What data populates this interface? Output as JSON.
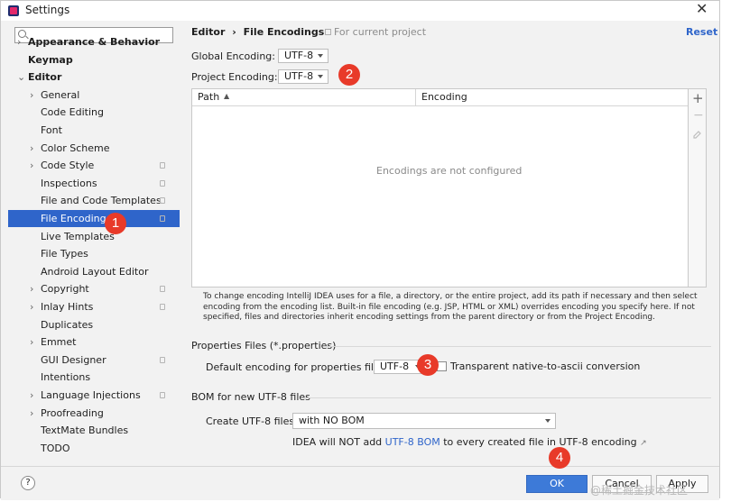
{
  "window": {
    "title": "Settings",
    "close_glyph": "✕"
  },
  "sidebar": {
    "search_placeholder": "",
    "items": [
      {
        "label": "Appearance & Behavior",
        "arrow": "›",
        "level": 0,
        "copy": false
      },
      {
        "label": "Keymap",
        "arrow": "",
        "level": 0,
        "copy": false
      },
      {
        "label": "Editor",
        "arrow": "⌄",
        "level": 0,
        "copy": false
      },
      {
        "label": "General",
        "arrow": "›",
        "level": 1,
        "copy": false
      },
      {
        "label": "Code Editing",
        "arrow": "",
        "level": 1,
        "copy": false
      },
      {
        "label": "Font",
        "arrow": "",
        "level": 1,
        "copy": false
      },
      {
        "label": "Color Scheme",
        "arrow": "›",
        "level": 1,
        "copy": false
      },
      {
        "label": "Code Style",
        "arrow": "›",
        "level": 1,
        "copy": true
      },
      {
        "label": "Inspections",
        "arrow": "",
        "level": 1,
        "copy": true
      },
      {
        "label": "File and Code Templates",
        "arrow": "",
        "level": 1,
        "copy": true
      },
      {
        "label": "File Encodings",
        "arrow": "",
        "level": 1,
        "copy": true
      },
      {
        "label": "Live Templates",
        "arrow": "",
        "level": 1,
        "copy": false
      },
      {
        "label": "File Types",
        "arrow": "",
        "level": 1,
        "copy": false
      },
      {
        "label": "Android Layout Editor",
        "arrow": "",
        "level": 1,
        "copy": false
      },
      {
        "label": "Copyright",
        "arrow": "›",
        "level": 1,
        "copy": true
      },
      {
        "label": "Inlay Hints",
        "arrow": "›",
        "level": 1,
        "copy": true
      },
      {
        "label": "Duplicates",
        "arrow": "",
        "level": 1,
        "copy": false
      },
      {
        "label": "Emmet",
        "arrow": "›",
        "level": 1,
        "copy": false
      },
      {
        "label": "GUI Designer",
        "arrow": "",
        "level": 1,
        "copy": true
      },
      {
        "label": "Intentions",
        "arrow": "",
        "level": 1,
        "copy": false
      },
      {
        "label": "Language Injections",
        "arrow": "›",
        "level": 1,
        "copy": true
      },
      {
        "label": "Proofreading",
        "arrow": "›",
        "level": 1,
        "copy": false
      },
      {
        "label": "TextMate Bundles",
        "arrow": "",
        "level": 1,
        "copy": false
      },
      {
        "label": "TODO",
        "arrow": "",
        "level": 1,
        "copy": false
      }
    ],
    "selected_index": 10
  },
  "header": {
    "breadcrumb_parent": "Editor",
    "breadcrumb_sep": "›",
    "breadcrumb_current": "File Encodings",
    "scope_note": "For current project",
    "reset": "Reset"
  },
  "global_encoding": {
    "label": "Global Encoding:",
    "value": "UTF-8"
  },
  "project_encoding": {
    "label": "Project Encoding:",
    "value": "UTF-8"
  },
  "table": {
    "col_path": "Path",
    "sort_glyph": "▲",
    "col_encoding": "Encoding",
    "empty_text": "Encodings are not configured",
    "add": "+",
    "remove": "−"
  },
  "help_text": "To change encoding IntelliJ IDEA uses for a file, a directory, or the entire project, add its path if necessary and then select encoding from the encoding list. Built-in file encoding (e.g. JSP, HTML or XML) overrides encoding you specify here. If not specified, files and directories inherit encoding settings from the parent directory or from the Project Encoding.",
  "properties": {
    "section_title": "Properties Files (*.properties)",
    "label": "Default encoding for properties files:",
    "value": "UTF-8",
    "checkbox_label": "Transparent native-to-ascii conversion",
    "checkbox_checked": false
  },
  "bom": {
    "section_title": "BOM for new UTF-8 files",
    "label": "Create UTF-8 files:",
    "value": "with NO BOM",
    "note_prefix": "IDEA will NOT add",
    "note_link": "UTF-8 BOM",
    "note_suffix": "to every created file in UTF-8 encoding",
    "external_glyph": "↗"
  },
  "badges": [
    "1",
    "2",
    "3",
    "4"
  ],
  "footer": {
    "help": "?",
    "ok": "OK",
    "cancel": "Cancel",
    "apply": "Apply"
  },
  "watermark": "@稀土掘金技术社区",
  "colors": {
    "selection": "#2f65ca",
    "accent": "#2f65ca",
    "badge": "#e83a29",
    "ok": "#3d7ad8"
  }
}
